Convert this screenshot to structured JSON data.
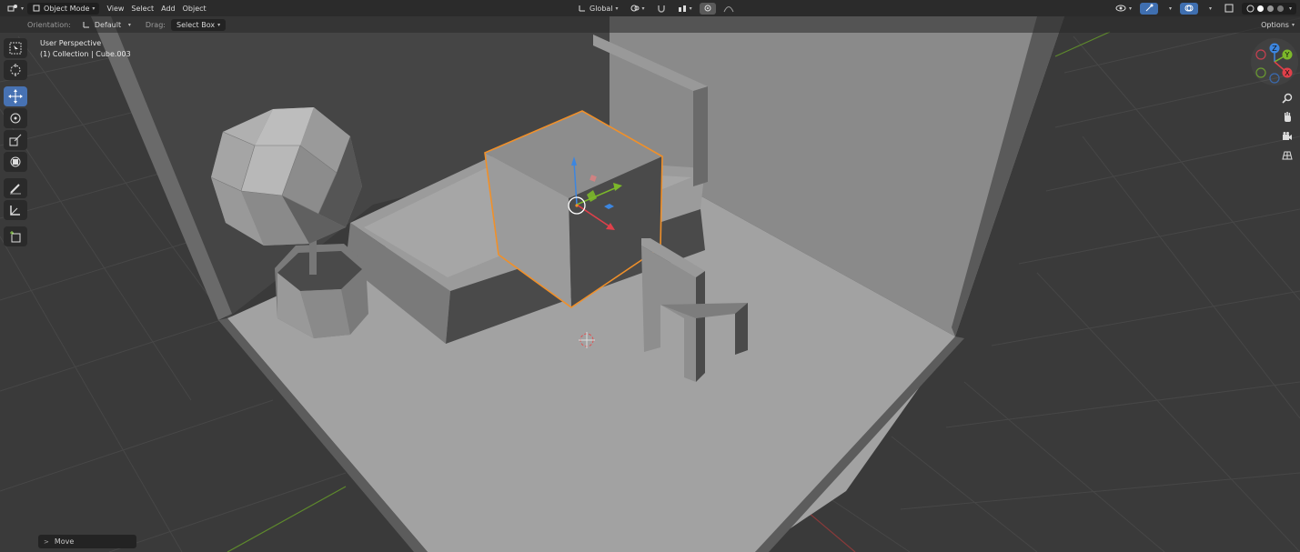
{
  "header": {
    "mode": "Object Mode",
    "menus": [
      "View",
      "Select",
      "Add",
      "Object"
    ],
    "transform_orientation": "Global"
  },
  "tool_settings": {
    "orientation_label": "Orientation:",
    "orientation_value": "Default",
    "drag_label": "Drag:",
    "drag_value": "Select Box",
    "options_label": "Options"
  },
  "viewport": {
    "view_name": "User Perspective",
    "collection_info": "(1) Collection | Cube.003"
  },
  "toolbar": {
    "tools": [
      "select-box",
      "cursor",
      "move",
      "rotate",
      "scale",
      "transform",
      "annotate",
      "measure",
      "add-cube"
    ],
    "active": "move"
  },
  "gizmo": {
    "x_label": "X",
    "y_label": "Y",
    "z_label": "Z"
  },
  "last_operator": {
    "label": "Move"
  },
  "colors": {
    "accent": "#4772b3",
    "selection": "#f0902a",
    "axis_x": "#e0404a",
    "axis_y": "#7cb82a",
    "axis_z": "#3c86e0"
  }
}
